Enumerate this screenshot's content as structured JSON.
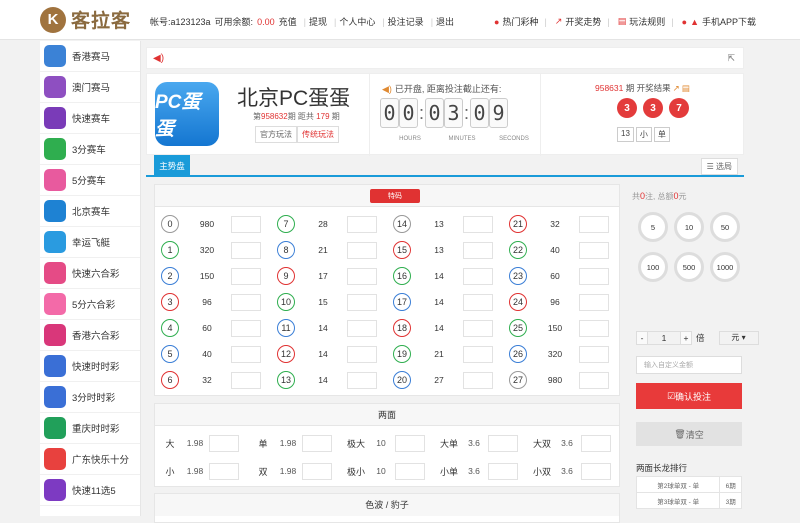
{
  "header": {
    "logo_char": "K",
    "logo_text": "客拉客",
    "account_label": "帐号:a123123a",
    "balance_label": "可用余额:",
    "balance_value": "0.00",
    "links": [
      "充值",
      "提现",
      "个人中心",
      "投注记录",
      "退出"
    ],
    "right_nav": [
      "热门彩种",
      "开奖走势",
      "玩法规则",
      "手机APP下载"
    ]
  },
  "sidebar": {
    "items": [
      {
        "label": "香港赛马",
        "color": "#3b82d6",
        "icon": "horse-racing-icon"
      },
      {
        "label": "澳门赛马",
        "color": "#8e4fc1",
        "icon": "horse-racing-icon"
      },
      {
        "label": "快速赛车",
        "color": "#7a3bb8",
        "icon": "race-car-icon"
      },
      {
        "label": "3分赛车",
        "color": "#2fae4f",
        "icon": "race-car-icon"
      },
      {
        "label": "5分赛车",
        "color": "#e85a9e",
        "icon": "race-car-icon"
      },
      {
        "label": "北京赛车",
        "color": "#1e82d3",
        "icon": "race-car-icon"
      },
      {
        "label": "幸运飞艇",
        "color": "#2a9be0",
        "icon": "airship-icon"
      },
      {
        "label": "快速六合彩",
        "color": "#e54b86",
        "icon": "lottery-icon"
      },
      {
        "label": "5分六合彩",
        "color": "#f36aa8",
        "icon": "lottery-icon"
      },
      {
        "label": "香港六合彩",
        "color": "#d9377a",
        "icon": "lottery-icon"
      },
      {
        "label": "快速时时彩",
        "color": "#3a6fd6",
        "icon": "lottery-icon"
      },
      {
        "label": "3分时时彩",
        "color": "#3a6fd6",
        "icon": "lottery-icon"
      },
      {
        "label": "重庆时时彩",
        "color": "#21a05a",
        "icon": "lottery-icon"
      },
      {
        "label": "广东快乐十分",
        "color": "#e8413e",
        "icon": "lottery-icon"
      },
      {
        "label": "快速11选5",
        "color": "#7d3ac2",
        "icon": "lottery-icon"
      }
    ]
  },
  "game": {
    "logo_text": "PC蛋蛋",
    "title": "北京PC蛋蛋",
    "period_prefix": "第",
    "period_no": "958632",
    "period_mid": "期 距共",
    "period_count": "179",
    "period_suffix": "期",
    "play_tabs": [
      "官方玩法",
      "传统玩法"
    ],
    "countdown_title": "已开盘, 距离投注截止还有:",
    "countdown": [
      "0",
      "0",
      "0",
      "3",
      "0",
      "9"
    ],
    "countdown_labels": [
      "HOURS",
      "MINUTES",
      "SECONDS"
    ],
    "result_period": "958631",
    "result_title": "期 开奖结果",
    "result_balls": [
      "3",
      "3",
      "7"
    ],
    "result_tags": [
      "13",
      "小",
      "单"
    ]
  },
  "tabs": {
    "main": "主势盘",
    "right": "选局"
  },
  "bet_grid": {
    "badge": "特码",
    "columns": [
      [
        {
          "n": "0",
          "o": "980"
        },
        {
          "n": "1",
          "o": "320"
        },
        {
          "n": "2",
          "o": "150"
        },
        {
          "n": "3",
          "o": "96"
        },
        {
          "n": "4",
          "o": "60"
        },
        {
          "n": "5",
          "o": "40"
        },
        {
          "n": "6",
          "o": "32"
        }
      ],
      [
        {
          "n": "7",
          "o": "28"
        },
        {
          "n": "8",
          "o": "21"
        },
        {
          "n": "9",
          "o": "17"
        },
        {
          "n": "10",
          "o": "15"
        },
        {
          "n": "11",
          "o": "14"
        },
        {
          "n": "12",
          "o": "14"
        },
        {
          "n": "13",
          "o": "14"
        }
      ],
      [
        {
          "n": "14",
          "o": "13"
        },
        {
          "n": "15",
          "o": "13"
        },
        {
          "n": "16",
          "o": "14"
        },
        {
          "n": "17",
          "o": "14"
        },
        {
          "n": "18",
          "o": "14"
        },
        {
          "n": "19",
          "o": "21"
        },
        {
          "n": "20",
          "o": "27"
        }
      ],
      [
        {
          "n": "21",
          "o": "32"
        },
        {
          "n": "22",
          "o": "40"
        },
        {
          "n": "23",
          "o": "60"
        },
        {
          "n": "24",
          "o": "96"
        },
        {
          "n": "25",
          "o": "150"
        },
        {
          "n": "26",
          "o": "320"
        },
        {
          "n": "27",
          "o": "980"
        }
      ]
    ],
    "ball_colors": [
      "#999999",
      "#2fae4f",
      "#3a7ed6",
      "#e03232",
      "#2fae4f",
      "#3a7ed6",
      "#e03232",
      "#2fae4f",
      "#3a7ed6",
      "#e03232",
      "#2fae4f",
      "#3a7ed6",
      "#e03232",
      "#2fae4f",
      "#999999",
      "#e03232",
      "#2fae4f",
      "#3a7ed6",
      "#e03232",
      "#2fae4f",
      "#3a7ed6",
      "#e03232",
      "#2fae4f",
      "#3a7ed6",
      "#e03232",
      "#2fae4f",
      "#3a7ed6",
      "#999999"
    ]
  },
  "liangmian": {
    "title": "两面",
    "cells": [
      {
        "label": "大",
        "odds": "1.98"
      },
      {
        "label": "单",
        "odds": "1.98"
      },
      {
        "label": "极大",
        "odds": "10"
      },
      {
        "label": "大单",
        "odds": "3.6"
      },
      {
        "label": "大双",
        "odds": "3.6"
      },
      {
        "label": "小",
        "odds": "1.98"
      },
      {
        "label": "双",
        "odds": "1.98"
      },
      {
        "label": "极小",
        "odds": "10"
      },
      {
        "label": "小单",
        "odds": "3.6"
      },
      {
        "label": "小双",
        "odds": "3.6"
      }
    ]
  },
  "sebo": {
    "title": "色波 / 豹子"
  },
  "bet_slip": {
    "summary_prefix": "共",
    "summary_count": "0",
    "summary_mid": "注, 总额",
    "summary_amount": "0",
    "summary_suffix": "元",
    "chips": [
      "5",
      "10",
      "50",
      "100",
      "500",
      "1000"
    ],
    "minus": "-",
    "multiplier": "1",
    "plus": "+",
    "times": "倍",
    "unit": "元",
    "custom_placeholder": "输入自定义金额",
    "confirm": "确认投注",
    "clear": "清空",
    "rank_title": "两面长龙排行",
    "rank_rows": [
      {
        "name": "第2球单双 - 单",
        "count": "6期"
      },
      {
        "name": "第3球单双 - 单",
        "count": "3期"
      }
    ]
  }
}
